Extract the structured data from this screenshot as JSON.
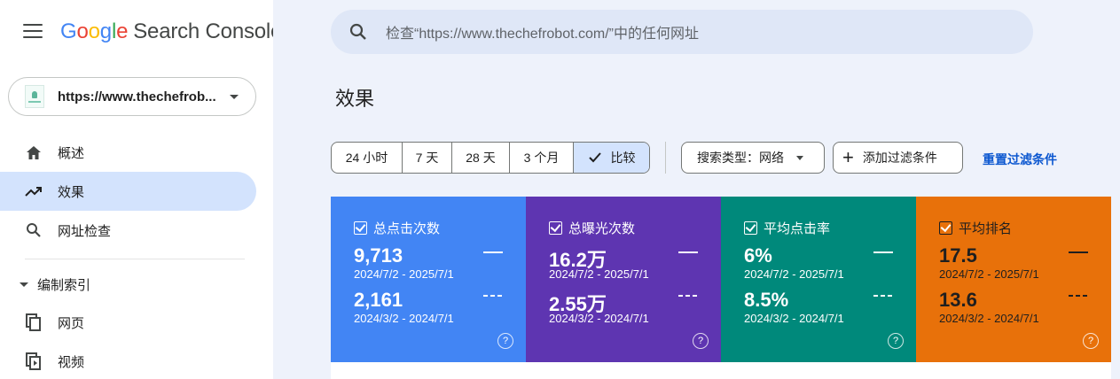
{
  "header": {
    "logo_google": [
      "G",
      "o",
      "o",
      "g",
      "l",
      "e"
    ],
    "logo_product": "Search Console",
    "search_placeholder": "检查“https://www.thechefrobot.com/”中的任何网址"
  },
  "property": {
    "url": "https://www.thechefrob..."
  },
  "sidebar": {
    "items": [
      {
        "label": "概述",
        "icon": "home-icon",
        "active": false
      },
      {
        "label": "效果",
        "icon": "trending-up-icon",
        "active": true
      },
      {
        "label": "网址检查",
        "icon": "search-icon",
        "active": false
      }
    ],
    "section": "编制索引",
    "sub_items": [
      {
        "label": "网页",
        "icon": "pages-icon"
      },
      {
        "label": "视频",
        "icon": "video-icon"
      }
    ]
  },
  "main": {
    "title": "效果",
    "date_ranges": [
      "24 小时",
      "7 天",
      "28 天",
      "3 个月",
      "比较"
    ],
    "selected_range": "比较",
    "search_type": "搜索类型：网络",
    "add_filter": "添加过滤条件",
    "reset_filters": "重置过滤条件"
  },
  "metrics": [
    {
      "name": "总点击次数",
      "color": "#4285f4",
      "current": "9,713",
      "current_range": "2024/7/2 - 2025/7/1",
      "previous": "2,161",
      "previous_range": "2024/3/2 - 2024/7/1"
    },
    {
      "name": "总曝光次数",
      "color": "#5e35b1",
      "current": "16.2万",
      "current_range": "2024/7/2 - 2025/7/1",
      "previous": "2.55万",
      "previous_range": "2024/3/2 - 2024/7/1"
    },
    {
      "name": "平均点击率",
      "color": "#00897b",
      "current": "6%",
      "current_range": "2024/7/2 - 2025/7/1",
      "previous": "8.5%",
      "previous_range": "2024/3/2 - 2024/7/1"
    },
    {
      "name": "平均排名",
      "color": "#e8710a",
      "current": "17.5",
      "current_range": "2024/7/2 - 2025/7/1",
      "previous": "13.6",
      "previous_range": "2024/3/2 - 2024/7/1"
    }
  ],
  "help_glyph": "?"
}
